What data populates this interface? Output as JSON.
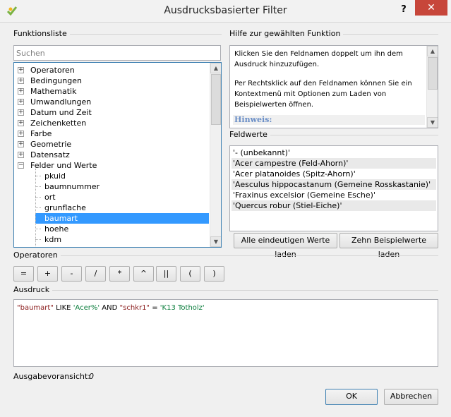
{
  "window": {
    "title": "Ausdrucksbasierter Filter",
    "help": "?",
    "close": "✕"
  },
  "funclist": {
    "header": "Funktionsliste",
    "search_placeholder": "Suchen",
    "groups": [
      "Operatoren",
      "Bedingungen",
      "Mathematik",
      "Umwandlungen",
      "Datum und Zeit",
      "Zeichenketten",
      "Farbe",
      "Geometrie",
      "Datensatz",
      "Felder und Werte"
    ],
    "fields": [
      "pkuid",
      "baumnummer",
      "ort",
      "grunflache",
      "baumart",
      "hoehe",
      "kdm"
    ],
    "selected_field": "baumart"
  },
  "helpsection": {
    "header": "Hilfe zur gewählten Funktion",
    "para1": "Klicken Sie den Feldnamen doppelt um ihn dem Ausdruck hinzuzufügen.",
    "para2": "Per Rechtsklick auf den Feldnamen können Sie ein Kontextmenü mit Optionen zum Laden von Beispielwerten öffnen.",
    "hinweis": "Hinweis:"
  },
  "fieldvalues": {
    "header": "Feldwerte",
    "values": [
      "'- (unbekannt)'",
      "'Acer campestre (Feld-Ahorn)'",
      "'Acer platanoides (Spitz-Ahorn)'",
      "'Aesculus hippocastanum (Gemeine Rosskastanie)'",
      "'Fraxinus excelsior (Gemeine Esche)'",
      "'Quercus robur (Stiel-Eiche)'"
    ],
    "load_all": "Alle eindeutigen Werte laden",
    "load_ten": "Zehn Beispielwerte laden"
  },
  "operators": {
    "header": "Operatoren",
    "buttons": [
      "=",
      "+",
      "-",
      "/",
      "*",
      "^",
      "||",
      "(",
      ")"
    ]
  },
  "expression": {
    "header": "Ausdruck",
    "tokens": [
      {
        "t": "\"baumart\"",
        "c": "fld"
      },
      {
        "t": " LIKE ",
        "c": ""
      },
      {
        "t": "'Acer%'",
        "c": "str"
      },
      {
        "t": " AND ",
        "c": ""
      },
      {
        "t": "\"schkr1\"",
        "c": "fld"
      },
      {
        "t": " = ",
        "c": ""
      },
      {
        "t": "'K13 Totholz'",
        "c": "str"
      }
    ]
  },
  "preview": {
    "label": "Ausgabevoransicht:",
    "value": "0"
  },
  "buttons": {
    "ok": "OK",
    "cancel": "Abbrechen"
  },
  "colors": {
    "selection": "#3399ff",
    "close": "#c7463a",
    "field": "#8a1b1b",
    "string": "#0a7d3c"
  }
}
